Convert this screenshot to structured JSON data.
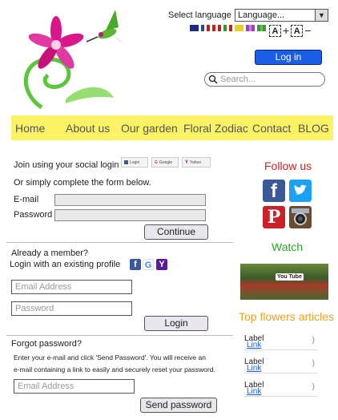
{
  "header": {
    "language_label": "Select language",
    "language_value": "Language...",
    "font_increase_label": "A",
    "font_plus": "+",
    "font_decrease_label": "A",
    "font_minus": "−",
    "login_label": "Log in",
    "search_placeholder": "Search...",
    "flag_colors": [
      [
        "#1a2a8a",
        "#1a2a8a",
        "#1a2a8a"
      ],
      [
        "#1a4fa0",
        "#ffffff",
        "#c02020"
      ],
      [
        "#c02020",
        "#ffffff",
        "#c02020"
      ],
      [
        "#2a9a2a",
        "#ffffff",
        "#c02020"
      ],
      [
        "#e8d020",
        "#e8d020",
        "#e8d020"
      ],
      [
        "#a040c0",
        "#d080e0",
        "#a040c0"
      ],
      [
        "#3a9a3a",
        "#6ac040",
        "#3a9a3a"
      ]
    ]
  },
  "nav": {
    "items": [
      "Home",
      "About us",
      "Our garden",
      "Floral Zodiac",
      "Contact",
      "BLOG"
    ]
  },
  "join": {
    "social_text": "Join using your social login",
    "social_buttons": [
      "Login",
      "Google",
      "Yahoo"
    ],
    "form_intro": "Or simply complete the form below.",
    "email_label": "E-mail",
    "password_label": "Password",
    "continue_label": "Continue"
  },
  "member": {
    "heading": "Already a member?",
    "profile_text": "Login with an existing profile",
    "icons": [
      "f",
      "G",
      "Y"
    ],
    "email_placeholder": "Email Address",
    "password_placeholder": "Password",
    "login_label": "Login"
  },
  "forgot": {
    "heading": "Forgot password?",
    "line1": "Enter your e-mail and click 'Send Password'. You will receive an",
    "line2": "e-mail containing a link to easily and securely reset your password.",
    "email_placeholder": "Email Address",
    "send_label": "Send password"
  },
  "sidebar": {
    "follow_heading": "Follow us",
    "follow_color": "#cc2222",
    "watch_heading": "Watch",
    "watch_color": "#22aa22",
    "articles_heading": "Top flowers articles",
    "articles_color": "#f0a020",
    "youtube_label": "You Tube",
    "articles": [
      {
        "label": "Label",
        "link": "Link"
      },
      {
        "label": "Label",
        "link": "Link"
      },
      {
        "label": "Label",
        "link": "Link"
      }
    ]
  }
}
